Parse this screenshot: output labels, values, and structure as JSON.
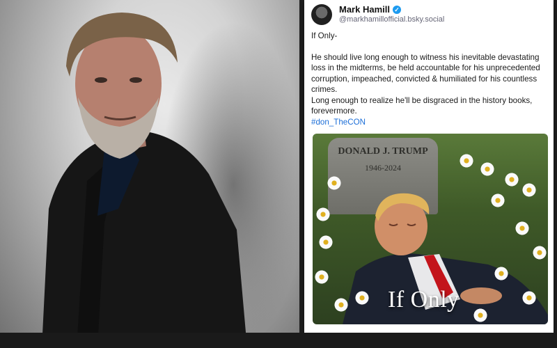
{
  "post": {
    "author_name": "Mark Hamill",
    "handle": "@markhamillofficial.bsky.social",
    "line_intro": "If Only-",
    "paragraph": "He should live long enough to witness his inevitable devastating loss in the midterms, be held accountable for his unprecedented corruption, impeached, convicted & humiliated for his countless crimes.",
    "paragraph2": "Long enough to realize he'll be disgraced in the history books, forevermore.",
    "hashtag": "#don_TheCON"
  },
  "image": {
    "gravestone_name": "DONALD J. TRUMP",
    "gravestone_dates": "1946-2024",
    "caption": "If Only"
  },
  "colors": {
    "verified": "#1d9bf0",
    "hashtag": "#1d6fd8"
  }
}
